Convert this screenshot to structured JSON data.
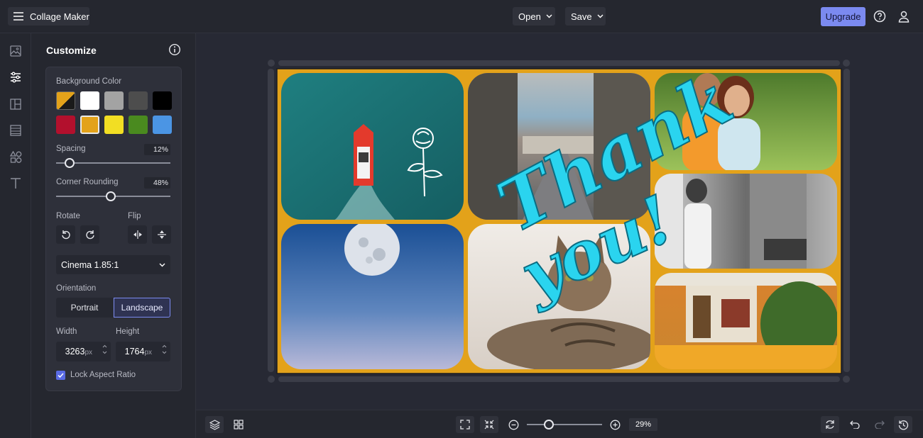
{
  "app": {
    "title": "Collage Maker"
  },
  "header": {
    "open_label": "Open",
    "save_label": "Save",
    "upgrade_label": "Upgrade"
  },
  "sidebar": {
    "title": "Customize",
    "background_color": {
      "label": "Background Color",
      "swatches": [
        "#e3a21a",
        "#ffffff",
        "#a3a3a3",
        "#4d4d4d",
        "#000000",
        "#b3102d",
        "#e3a21a",
        "#f2de23",
        "#4a8a1f",
        "#4b95e4"
      ]
    },
    "spacing": {
      "label": "Spacing",
      "value": "12%",
      "level": 0.12
    },
    "corner_rounding": {
      "label": "Corner Rounding",
      "value": "48%",
      "level": 0.48
    },
    "rotate_label": "Rotate",
    "flip_label": "Flip",
    "ratio_select": {
      "selected": "Cinema 1.85:1"
    },
    "orientation": {
      "label": "Orientation",
      "portrait_label": "Portrait",
      "landscape_label": "Landscape",
      "selected": "Landscape"
    },
    "width": {
      "label": "Width",
      "value": "3263",
      "unit": "px"
    },
    "height": {
      "label": "Height",
      "value": "1764",
      "unit": "px"
    },
    "lock_aspect": {
      "label": "Lock Aspect Ratio",
      "checked": true
    }
  },
  "canvas": {
    "background_color": "#e3a21a",
    "overlay_text_line1": "Thank",
    "overlay_text_line2": "you!",
    "overlay_text_color": "#2ad4ef",
    "photos": [
      "boat-with-rose-photo",
      "street-view-photo",
      "couple-photo",
      "moon-sky-photo",
      "cat-photo",
      "barber-photo",
      "house-photo"
    ]
  },
  "bottombar": {
    "zoom_value": "29%",
    "zoom_level": 0.29
  },
  "colors": {
    "accent": "#7b8af0",
    "app_bg": "#272934",
    "panel_bg": "#25272f"
  }
}
